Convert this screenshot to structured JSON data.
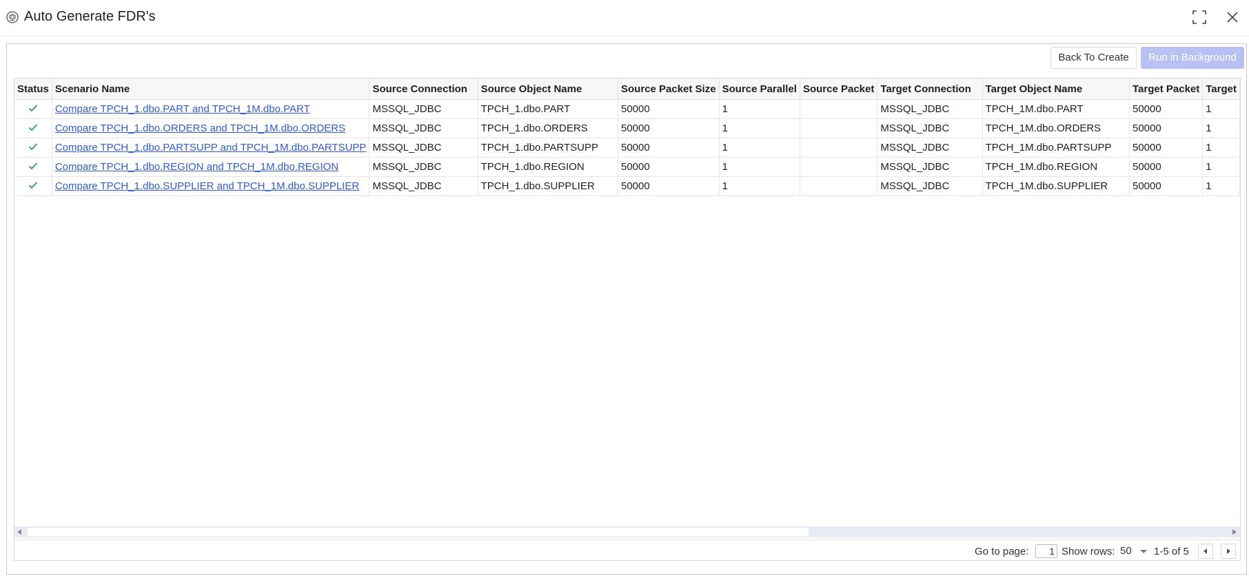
{
  "window": {
    "title": "Auto Generate FDR's"
  },
  "toolbar": {
    "back_label": "Back To Create",
    "run_label": "Run in Background"
  },
  "table": {
    "columns": [
      "Status",
      "Scenario Name",
      "Source Connection",
      "Source Object Name",
      "Source Packet Size",
      "Source Parallel",
      "Source Packet",
      "Target Connection",
      "Target Object Name",
      "Target Packet",
      "Target"
    ],
    "rows": [
      {
        "status": "success",
        "scenario": "Compare TPCH_1.dbo.PART and TPCH_1M.dbo.PART",
        "source_connection": "MSSQL_JDBC",
        "source_object": "TPCH_1.dbo.PART",
        "source_packet_size": "50000",
        "source_parallel": "1",
        "source_packet": "",
        "target_connection": "MSSQL_JDBC",
        "target_object": "TPCH_1M.dbo.PART",
        "target_packet": "50000",
        "target_parallel": "1"
      },
      {
        "status": "success",
        "scenario": "Compare TPCH_1.dbo.ORDERS and TPCH_1M.dbo.ORDERS",
        "source_connection": "MSSQL_JDBC",
        "source_object": "TPCH_1.dbo.ORDERS",
        "source_packet_size": "50000",
        "source_parallel": "1",
        "source_packet": "",
        "target_connection": "MSSQL_JDBC",
        "target_object": "TPCH_1M.dbo.ORDERS",
        "target_packet": "50000",
        "target_parallel": "1"
      },
      {
        "status": "success",
        "scenario": "Compare TPCH_1.dbo.PARTSUPP and TPCH_1M.dbo.PARTSUPP",
        "source_connection": "MSSQL_JDBC",
        "source_object": "TPCH_1.dbo.PARTSUPP",
        "source_packet_size": "50000",
        "source_parallel": "1",
        "source_packet": "",
        "target_connection": "MSSQL_JDBC",
        "target_object": "TPCH_1M.dbo.PARTSUPP",
        "target_packet": "50000",
        "target_parallel": "1"
      },
      {
        "status": "success",
        "scenario": "Compare TPCH_1.dbo.REGION and TPCH_1M.dbo.REGION",
        "source_connection": "MSSQL_JDBC",
        "source_object": "TPCH_1.dbo.REGION",
        "source_packet_size": "50000",
        "source_parallel": "1",
        "source_packet": "",
        "target_connection": "MSSQL_JDBC",
        "target_object": "TPCH_1M.dbo.REGION",
        "target_packet": "50000",
        "target_parallel": "1"
      },
      {
        "status": "success",
        "scenario": "Compare TPCH_1.dbo.SUPPLIER and TPCH_1M.dbo.SUPPLIER",
        "source_connection": "MSSQL_JDBC",
        "source_object": "TPCH_1.dbo.SUPPLIER",
        "source_packet_size": "50000",
        "source_parallel": "1",
        "source_packet": "",
        "target_connection": "MSSQL_JDBC",
        "target_object": "TPCH_1M.dbo.SUPPLIER",
        "target_packet": "50000",
        "target_parallel": "1"
      }
    ]
  },
  "pagination": {
    "goto_label": "Go to page:",
    "page": "1",
    "rows_label": "Show rows:",
    "rows": "50",
    "range": "1-5 of 5"
  },
  "colors": {
    "link": "#2f5bd8",
    "check": "#2e9e44",
    "run_button_disabled": "#b9c0f3",
    "scrollbar_track": "#e6ebf5"
  },
  "icons": {
    "app": "robot-icon",
    "maximize": "maximize-icon",
    "close": "close-icon",
    "status": "check-icon"
  }
}
